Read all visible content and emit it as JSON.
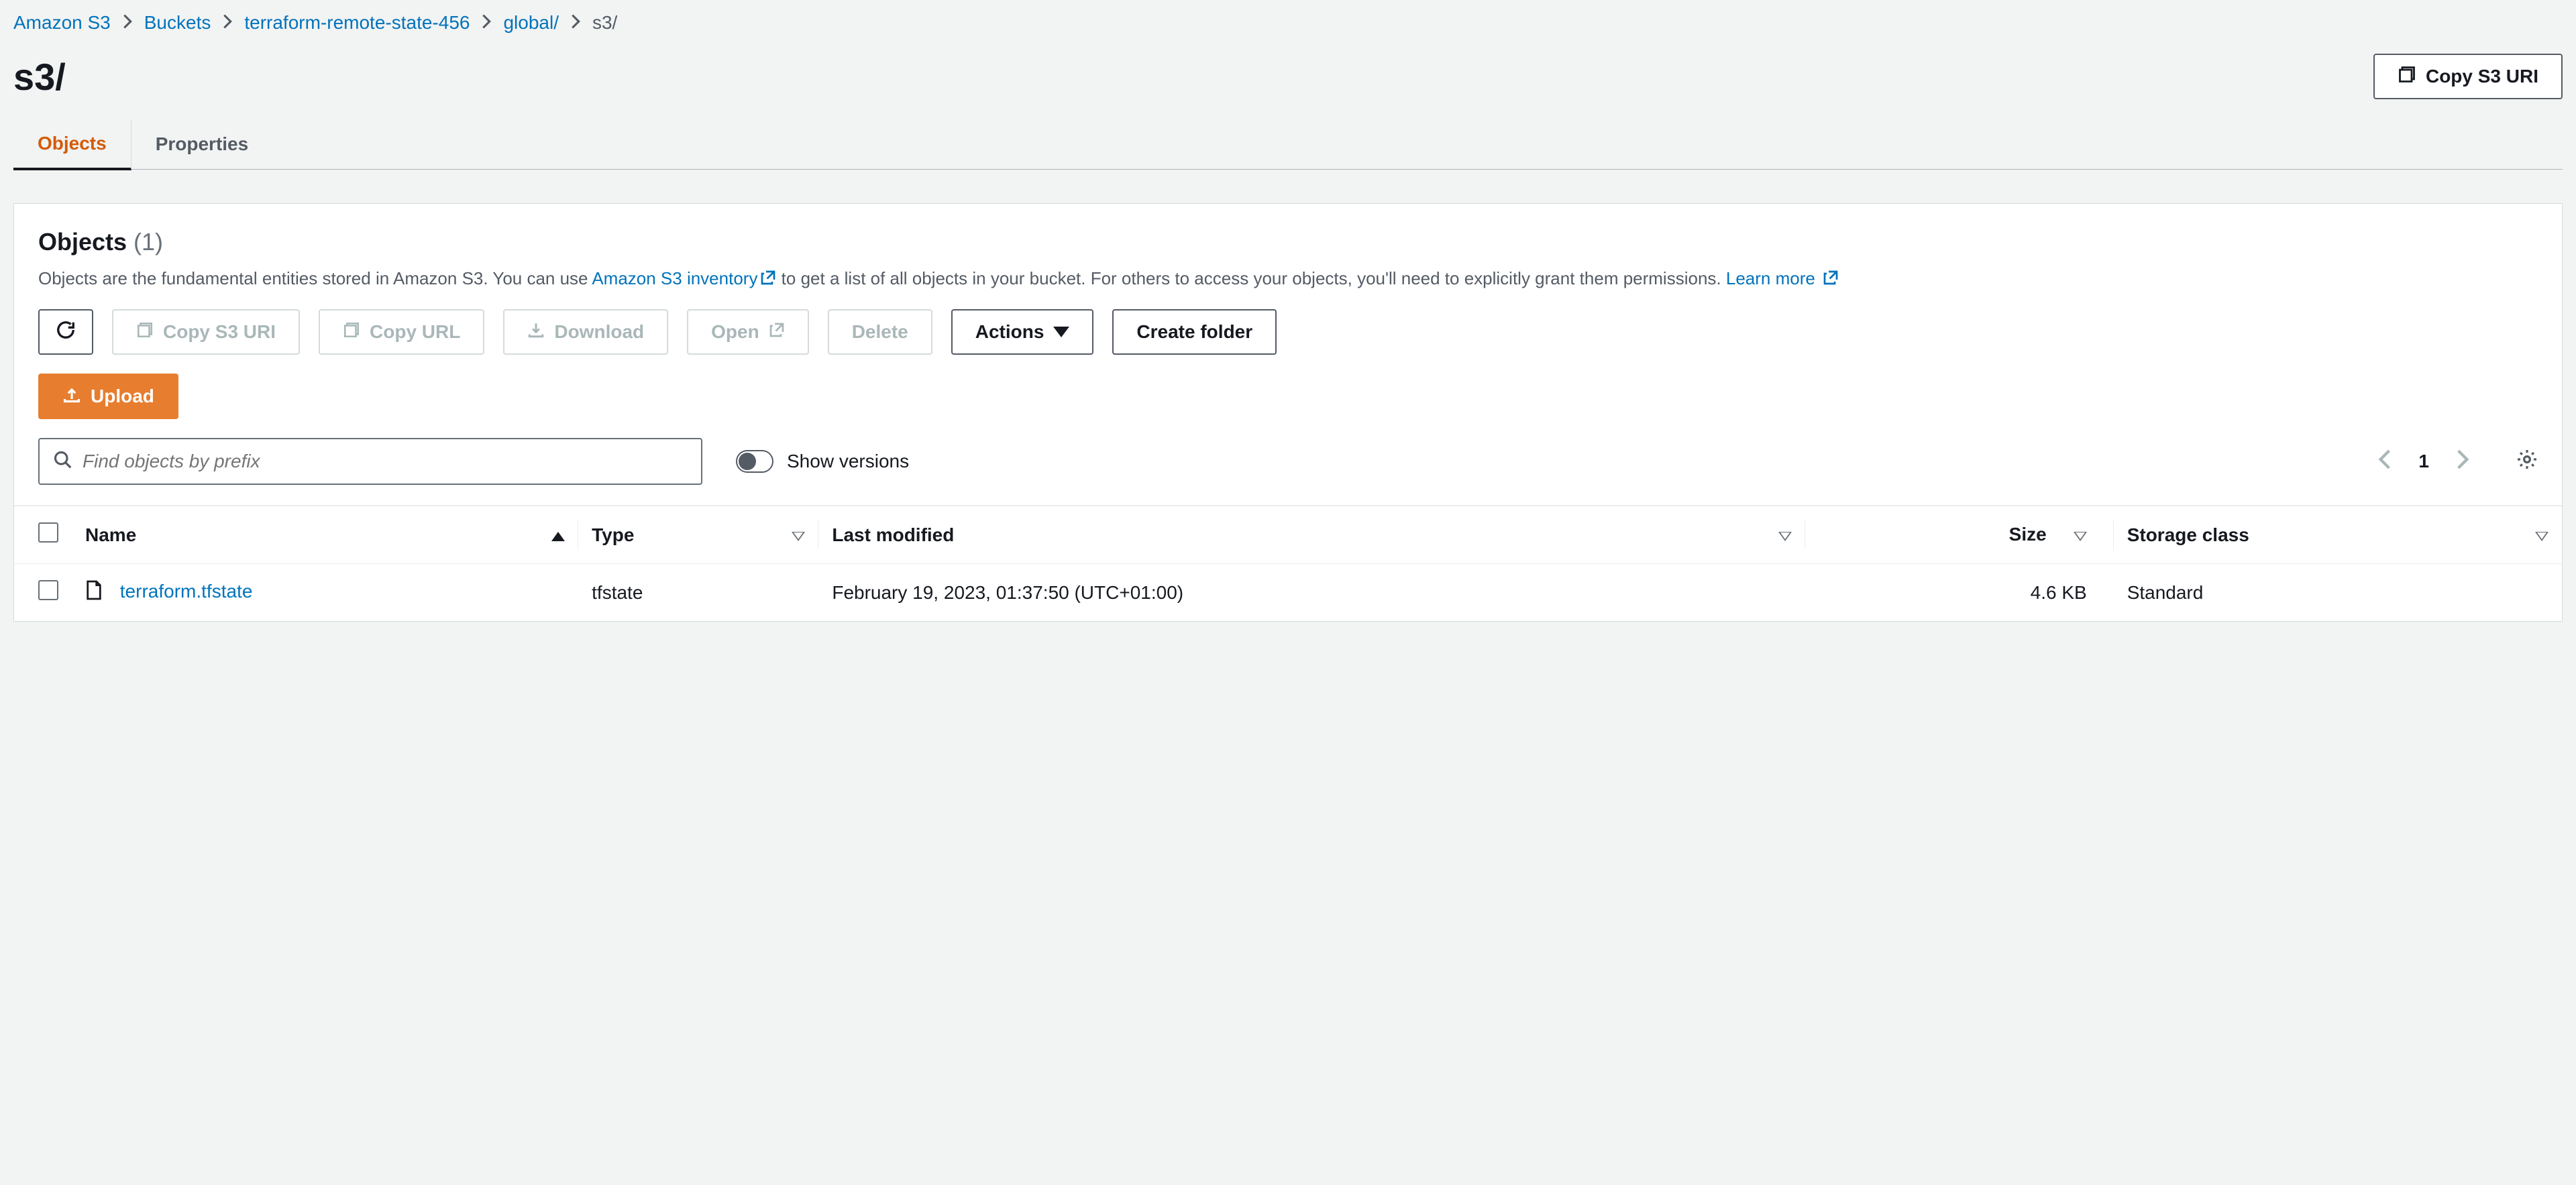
{
  "breadcrumb": {
    "items": [
      {
        "label": "Amazon S3"
      },
      {
        "label": "Buckets"
      },
      {
        "label": "terraform-remote-state-456"
      },
      {
        "label": "global/"
      },
      {
        "label": "s3/"
      }
    ]
  },
  "title": "s3/",
  "title_actions": {
    "copy_uri": "Copy S3 URI"
  },
  "tabs": [
    {
      "label": "Objects",
      "active": true
    },
    {
      "label": "Properties",
      "active": false
    }
  ],
  "panel": {
    "heading": "Objects",
    "count": "(1)",
    "desc_pre": "Objects are the fundamental entities stored in Amazon S3. You can use ",
    "desc_link1": "Amazon S3 inventory",
    "desc_mid": " to get a list of all objects in your bucket. For others to access your objects, you'll need to explicitly grant them permissions. ",
    "desc_link2": "Learn more"
  },
  "buttons": {
    "copy_uri": "Copy S3 URI",
    "copy_url": "Copy URL",
    "download": "Download",
    "open": "Open",
    "delete": "Delete",
    "actions": "Actions",
    "create_folder": "Create folder",
    "upload": "Upload"
  },
  "search": {
    "placeholder": "Find objects by prefix",
    "toggle_label": "Show versions",
    "page": "1"
  },
  "table": {
    "headers": {
      "name": "Name",
      "type": "Type",
      "last_modified": "Last modified",
      "size": "Size",
      "storage_class": "Storage class"
    },
    "rows": [
      {
        "name": "terraform.tfstate",
        "type": "tfstate",
        "last_modified": "February 19, 2023, 01:37:50 (UTC+01:00)",
        "size": "4.6 KB",
        "storage_class": "Standard"
      }
    ]
  }
}
